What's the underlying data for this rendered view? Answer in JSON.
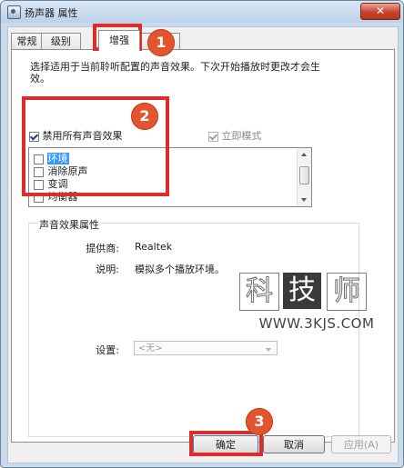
{
  "window": {
    "title": "扬声器 属性",
    "close_glyph": "✕"
  },
  "tabs": [
    {
      "label": "常规"
    },
    {
      "label": "级别"
    },
    {
      "label": "增强"
    }
  ],
  "enhancements": {
    "description": "选择适用于当前聆听配置的声音效果。下次开始播放时更改才会生效。",
    "disable_all": {
      "label": "禁用所有声音效果",
      "checked": true
    },
    "immediate_mode": {
      "label": "立即模式",
      "checked": true,
      "enabled": false
    },
    "items": [
      {
        "label": "环境",
        "checked": false,
        "selected": true
      },
      {
        "label": "消除原声",
        "checked": false
      },
      {
        "label": "变调",
        "checked": false
      },
      {
        "label": "均衡器",
        "checked": false
      }
    ]
  },
  "properties": {
    "group_label": "声音效果属性",
    "provider_label": "提供商:",
    "provider_value": "Realtek",
    "description_label": "说明:",
    "description_value": "模拟多个播放环境。",
    "settings_label": "设置:",
    "settings_value": "<无>"
  },
  "watermark": {
    "chars": [
      "科",
      "技",
      "师"
    ],
    "url": "WWW.3KJS.COM"
  },
  "buttons": {
    "ok": "确定",
    "cancel": "取消",
    "apply": "应用(A)"
  },
  "annotations": [
    "1",
    "2",
    "3"
  ],
  "colors": {
    "highlight": "#e02b2b",
    "badge": "#e3552f",
    "selection": "#3399ff"
  }
}
